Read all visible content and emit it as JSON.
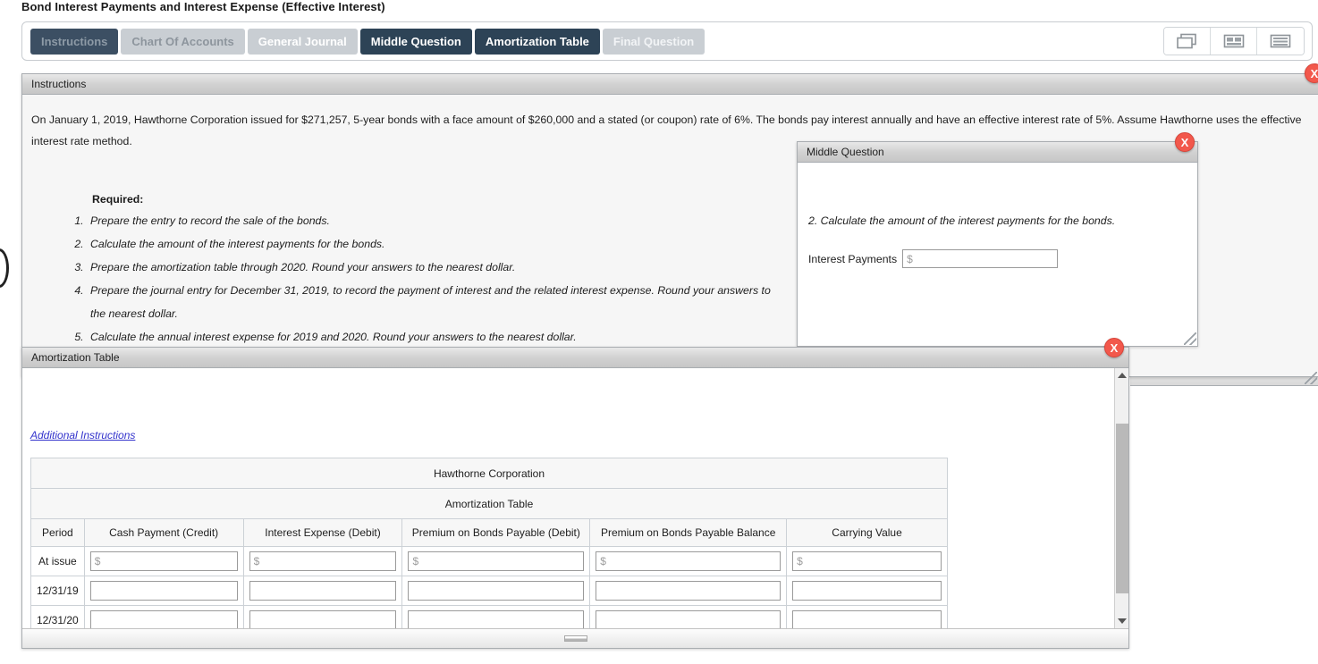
{
  "page": {
    "title": "Bond Interest Payments and Interest Expense (Effective Interest)"
  },
  "tabs": [
    {
      "label": "Instructions",
      "state": "dim-dark"
    },
    {
      "label": "Chart Of Accounts",
      "state": "muted"
    },
    {
      "label": "General Journal",
      "state": "light"
    },
    {
      "label": "Middle Question",
      "state": "active"
    },
    {
      "label": "Amortization Table",
      "state": "active"
    },
    {
      "label": "Final Question",
      "state": "pale"
    }
  ],
  "toolbar": {
    "layout_buttons": [
      {
        "name": "cascade-windows-icon",
        "title": "Cascade"
      },
      {
        "name": "split-view-icon",
        "title": "Split"
      },
      {
        "name": "list-view-icon",
        "title": "List"
      }
    ]
  },
  "instructions": {
    "title": "Instructions",
    "close_label": "X",
    "paragraph": "On January 1, 2019, Hawthorne Corporation issued for $271,257, 5-year bonds with a face amount of $260,000 and a stated (or coupon) rate of 6%. The bonds pay interest annually and have an effective interest rate of 5%. Assume Hawthorne uses the effective interest rate method.",
    "required_label": "Required:",
    "requirements": [
      "Prepare the entry to record the sale of the bonds.",
      "Calculate the amount of the interest payments for the bonds.",
      "Prepare the amortization table through 2020. Round your answers to the nearest dollar.",
      "Prepare the journal entry for December 31, 2019, to record the payment of interest and the related interest expense. Round your answers to the nearest dollar.",
      "Calculate the annual interest expense for 2019 and 2020. Round your answers to the nearest dollar."
    ]
  },
  "middle_question": {
    "title": "Middle Question",
    "close_label": "X",
    "question": "2. Calculate the amount of the interest payments for the bonds.",
    "field_label": "Interest Payments",
    "field_value": "",
    "field_placeholder": "$"
  },
  "amortization": {
    "title": "Amortization Table",
    "close_label": "X",
    "additional_instructions_link": "Additional Instructions",
    "table": {
      "company": "Hawthorne Corporation",
      "caption": "Amortization Table",
      "columns": [
        "Period",
        "Cash Payment (Credit)",
        "Interest Expense (Debit)",
        "Premium on Bonds Payable (Debit)",
        "Premium on Bonds Payable Balance",
        "Carrying Value"
      ],
      "rows": [
        {
          "period": "At issue",
          "cells": [
            {
              "value": "",
              "placeholder": "$"
            },
            {
              "value": "",
              "placeholder": "$"
            },
            {
              "value": "",
              "placeholder": "$"
            },
            {
              "value": "",
              "placeholder": "$"
            },
            {
              "value": "",
              "placeholder": "$"
            }
          ]
        },
        {
          "period": "12/31/19",
          "cells": [
            {
              "value": "",
              "placeholder": ""
            },
            {
              "value": "",
              "placeholder": ""
            },
            {
              "value": "",
              "placeholder": ""
            },
            {
              "value": "",
              "placeholder": ""
            },
            {
              "value": "",
              "placeholder": ""
            }
          ]
        },
        {
          "period": "12/31/20",
          "cells": [
            {
              "value": "",
              "placeholder": ""
            },
            {
              "value": "",
              "placeholder": ""
            },
            {
              "value": "",
              "placeholder": ""
            },
            {
              "value": "",
              "placeholder": ""
            },
            {
              "value": "",
              "placeholder": ""
            }
          ]
        }
      ]
    }
  },
  "colors": {
    "tab_active": "#2d4356",
    "tab_inactive": "#c9ced3",
    "close_red": "#f2584c",
    "link_blue": "#3333cc"
  }
}
